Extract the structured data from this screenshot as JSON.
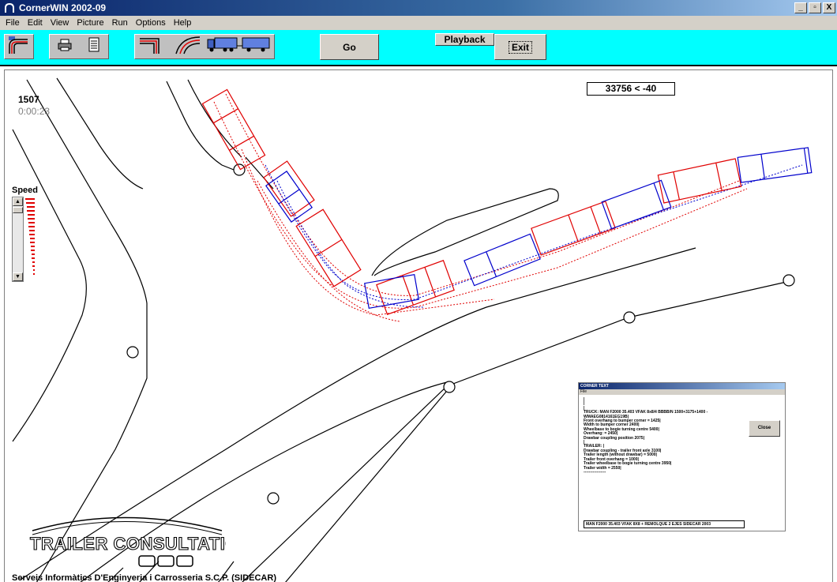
{
  "window": {
    "title": "CornerWIN 2002-09",
    "buttons": {
      "minimize": "_",
      "restore": "▫",
      "close": "X"
    }
  },
  "menu": [
    "File",
    "Edit",
    "View",
    "Picture",
    "Run",
    "Options",
    "Help"
  ],
  "toolbar": {
    "go_label": "Go",
    "playback_label": "Playback",
    "exit_label": "Exit"
  },
  "icons": {
    "app": "cornerwin-logo-icon",
    "layout": "road-layout-icon",
    "print": "printer-icon",
    "text": "document-icon",
    "corner_right": "corner-90-icon",
    "corner_curve": "curved-corner-icon",
    "vehicle": "truck-trailer-icon"
  },
  "status": {
    "readout": "33756 < -40",
    "frame_number": "1507",
    "elapsed": "0:00:23"
  },
  "speed": {
    "label": "Speed",
    "level": 0.9
  },
  "logo": {
    "name": "TRAILER CONSULTATION",
    "mark": "OOO"
  },
  "footer": "Serveis Informàtics D'Enginyeria i Carrosseria S.C.P. (SIDECAR)",
  "corner_text_dialog": {
    "title": "CORNER TEXT",
    "menu": "File",
    "close_label": "Close",
    "lines": [
      "|",
      "|",
      "|",
      "TRUCK:  MAN F2000  35.403 VFAK 8x8/4 BBBB/N 1500+3175+1400 -",
      "WMAEG0814161EG19B|",
      "Front overhang to bumper corner =  1425|",
      "Width to bumper corner 2400|",
      "Wheelbase to bogie turning centre  5400|",
      "Overhang:  =  2450|",
      "Drawbar coupling position 2075|",
      "|",
      "TRAILER: |",
      "Drawbar coupling - trailer front axle 3100|",
      "Trailer length (without drawbar) =  5000|",
      "Trailer front overhang =  1000|",
      "Trailer wheelbase to bogie turning centre 3950|",
      "Trailer width =  2550|",
      "-----------------"
    ],
    "field_value": "MAN F2000 35.403 VFAK 8X8 + REMOLQUE 2 EJES SIDECAR 2003"
  },
  "colors": {
    "toolbar_bg": "#00ffff",
    "truck": "#e00000",
    "trailer": "#0000cc",
    "road": "#000000"
  }
}
